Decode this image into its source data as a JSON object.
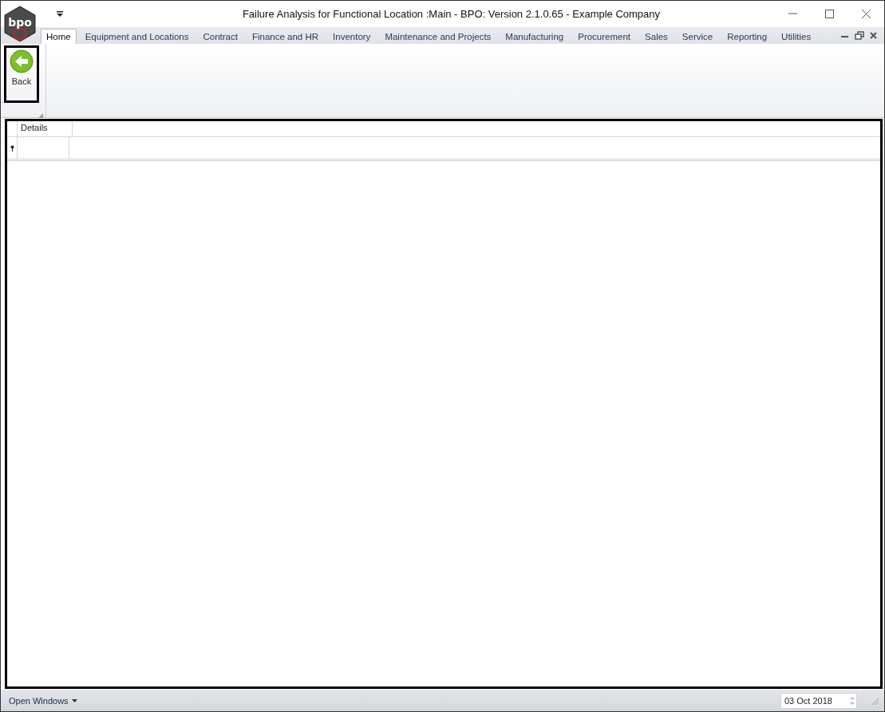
{
  "window": {
    "title": "Failure Analysis for Functional Location :Main - BPO: Version 2.1.0.65 - Example Company",
    "logo_text": "bpo"
  },
  "tabs": [
    {
      "label": "Home",
      "selected": true
    },
    {
      "label": "Equipment and Locations",
      "selected": false
    },
    {
      "label": "Contract",
      "selected": false
    },
    {
      "label": "Finance and HR",
      "selected": false
    },
    {
      "label": "Inventory",
      "selected": false
    },
    {
      "label": "Maintenance and Projects",
      "selected": false
    },
    {
      "label": "Manufacturing",
      "selected": false
    },
    {
      "label": "Procurement",
      "selected": false
    },
    {
      "label": "Sales",
      "selected": false
    },
    {
      "label": "Service",
      "selected": false
    },
    {
      "label": "Reporting",
      "selected": false
    },
    {
      "label": "Utilities",
      "selected": false
    }
  ],
  "ribbon": {
    "buttons": [
      {
        "label": "Back"
      }
    ]
  },
  "grid": {
    "columns": [
      "Details"
    ]
  },
  "status_bar": {
    "open_windows": "Open Windows",
    "date": "03 Oct 2018"
  }
}
